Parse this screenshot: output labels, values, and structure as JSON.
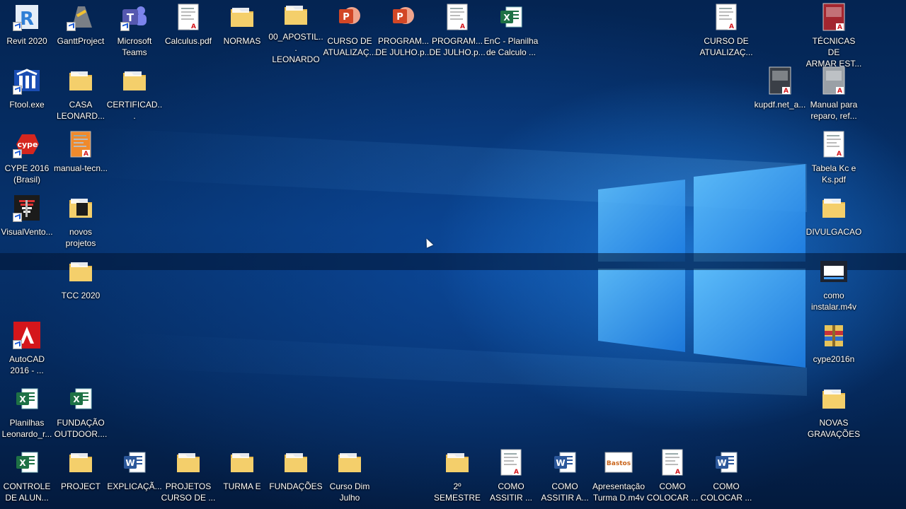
{
  "desktop": {
    "icons": [
      {
        "label": "Revit 2020",
        "icon": "revit-icon",
        "kind": "app-revit",
        "color": "#2f7fd6",
        "letter": "R"
      },
      {
        "label": "GanttProject",
        "icon": "ganttproject-icon",
        "kind": "app-gantt",
        "color": "#7a7f86",
        "letter": ""
      },
      {
        "label": "Microsoft\nTeams",
        "icon": "teams-icon",
        "kind": "app-teams",
        "color": "#5558af",
        "letter": "T"
      },
      {
        "label": "Calculus.pdf",
        "icon": "pdf-file-icon",
        "kind": "pdf",
        "color": "#ffffff",
        "letter": ""
      },
      {
        "label": "NORMAS",
        "icon": "folder-icon",
        "kind": "folder",
        "color": "#f4cf6b",
        "letter": ""
      },
      {
        "label": "00_APOSTIL...\nLEONARDO",
        "icon": "folder-icon",
        "kind": "folder",
        "color": "#f4cf6b",
        "letter": ""
      },
      {
        "label": "CURSO DE\nATUALIZAÇ...",
        "icon": "powerpoint-file-icon",
        "kind": "ppt",
        "color": "#d24726",
        "letter": "P"
      },
      {
        "label": "PROGRAM...\nDE JULHO.p...",
        "icon": "powerpoint-pdf-icon",
        "kind": "ppt",
        "color": "#d24726",
        "letter": "P"
      },
      {
        "label": "PROGRAM...\nDE JULHO.p...",
        "icon": "pdf-document-icon",
        "kind": "pdfdoc",
        "color": "#ffffff",
        "letter": ""
      },
      {
        "label": "EnC - Planilha\nde Calculo ...",
        "icon": "excel-file-icon",
        "kind": "excel",
        "color": "#1e7145",
        "letter": "X"
      },
      {
        "label": "CURSO DE\nATUALIZAÇ...",
        "icon": "pdf-file-icon",
        "kind": "pdf",
        "color": "#ffffff",
        "letter": ""
      },
      {
        "label": "TÉCNICAS DE\nARMAR EST...",
        "icon": "pdf-book-icon",
        "kind": "pdfbook",
        "color": "#a3262f",
        "letter": ""
      },
      {
        "label": "Ftool.exe",
        "icon": "ftool-icon",
        "kind": "app-ftool",
        "color": "#1a4db3",
        "letter": "F"
      },
      {
        "label": "CASA\nLEONARD...",
        "icon": "folder-excel-icon",
        "kind": "folder",
        "color": "#f4cf6b",
        "letter": ""
      },
      {
        "label": "CERTIFICAD...",
        "icon": "folder-icon",
        "kind": "folder",
        "color": "#f4cf6b",
        "letter": ""
      },
      {
        "label": "kupdf.net_a...",
        "icon": "pdf-book-icon",
        "kind": "pdfbook",
        "color": "#3a3f47",
        "letter": ""
      },
      {
        "label": "Manual para\nreparo, ref...",
        "icon": "pdf-book-icon",
        "kind": "pdfbook",
        "color": "#9aa0a6",
        "letter": ""
      },
      {
        "label": "CYPE 2016\n(Brasil)",
        "icon": "cype-icon",
        "kind": "app-cype",
        "color": "#d5261e",
        "letter": "cype"
      },
      {
        "label": "manual-tecn...",
        "icon": "pdf-document-icon",
        "kind": "pdfdoc",
        "color": "#f08a2c",
        "letter": ""
      },
      {
        "label": "Tabela Kc e\nKs.pdf",
        "icon": "pdf-document-icon",
        "kind": "pdfdoc",
        "color": "#ffffff",
        "letter": ""
      },
      {
        "label": "VisualVento...",
        "icon": "visualventos-icon",
        "kind": "app-vento",
        "color": "#1b1b1b",
        "letter": ""
      },
      {
        "label": "novos\nprojetos",
        "icon": "folder-icon",
        "kind": "folderdark",
        "color": "#f4cf6b",
        "letter": ""
      },
      {
        "label": "DIVULGACAO",
        "icon": "folder-icon",
        "kind": "folder",
        "color": "#f4cf6b",
        "letter": ""
      },
      {
        "label": "TCC 2020",
        "icon": "folder-icon",
        "kind": "folder",
        "color": "#f4cf6b",
        "letter": ""
      },
      {
        "label": "como\ninstalar.m4v",
        "icon": "video-file-icon",
        "kind": "video",
        "color": "#1c2331",
        "letter": ""
      },
      {
        "label": "AutoCAD\n2016 - ...",
        "icon": "autocad-icon",
        "kind": "app-autocad",
        "color": "#d4161b",
        "letter": "A"
      },
      {
        "label": "cype2016n",
        "icon": "archive-icon",
        "kind": "archive",
        "color": "#c8323a",
        "letter": ""
      },
      {
        "label": "Planilhas\nLeonardo_r...",
        "icon": "excel-file-icon",
        "kind": "excel",
        "color": "#1e7145",
        "letter": "X"
      },
      {
        "label": "FUNDAÇÃO\nOUTDOOR....",
        "icon": "excel-file-icon",
        "kind": "excel",
        "color": "#1e7145",
        "letter": "X"
      },
      {
        "label": "NOVAS\nGRAVAÇÕES",
        "icon": "folder-icon",
        "kind": "folder",
        "color": "#f4cf6b",
        "letter": ""
      },
      {
        "label": "CONTROLE\nDE ALUN...",
        "icon": "excel-file-icon",
        "kind": "excel",
        "color": "#1e7145",
        "letter": "X"
      },
      {
        "label": "PROJECT",
        "icon": "folder-icon",
        "kind": "folder",
        "color": "#f4cf6b",
        "letter": ""
      },
      {
        "label": "EXPLICAÇÃ...",
        "icon": "word-file-icon",
        "kind": "word",
        "color": "#2b579a",
        "letter": "W"
      },
      {
        "label": "PROJETOS\nCURSO DE ...",
        "icon": "folder-icon",
        "kind": "folder",
        "color": "#f4cf6b",
        "letter": ""
      },
      {
        "label": "TURMA E",
        "icon": "folder-icon",
        "kind": "folder",
        "color": "#f4cf6b",
        "letter": ""
      },
      {
        "label": "FUNDAÇÕES",
        "icon": "folder-icon",
        "kind": "folder",
        "color": "#f4cf6b",
        "letter": ""
      },
      {
        "label": "Curso Dim\nJulho",
        "icon": "folder-icon",
        "kind": "folder",
        "color": "#f4cf6b",
        "letter": ""
      },
      {
        "label": "2º SEMESTRE",
        "icon": "folder-icon",
        "kind": "folder",
        "color": "#f4cf6b",
        "letter": ""
      },
      {
        "label": "COMO\nASSITIR ...",
        "icon": "pdf-document-icon",
        "kind": "pdfdoc",
        "color": "#ffffff",
        "letter": ""
      },
      {
        "label": "COMO\nASSITIR A...",
        "icon": "word-file-icon",
        "kind": "word",
        "color": "#2b579a",
        "letter": "W"
      },
      {
        "label": "Apresentação\nTurma D.m4v",
        "icon": "video-file-icon",
        "kind": "videologo",
        "color": "#ffffff",
        "letter": "Bastos"
      },
      {
        "label": "COMO\nCOLOCAR ...",
        "icon": "pdf-document-icon",
        "kind": "pdfdoc",
        "color": "#ffffff",
        "letter": ""
      },
      {
        "label": "COMO\nCOLOCAR ...",
        "icon": "word-file-icon",
        "kind": "word",
        "color": "#2b579a",
        "letter": "W"
      }
    ]
  }
}
